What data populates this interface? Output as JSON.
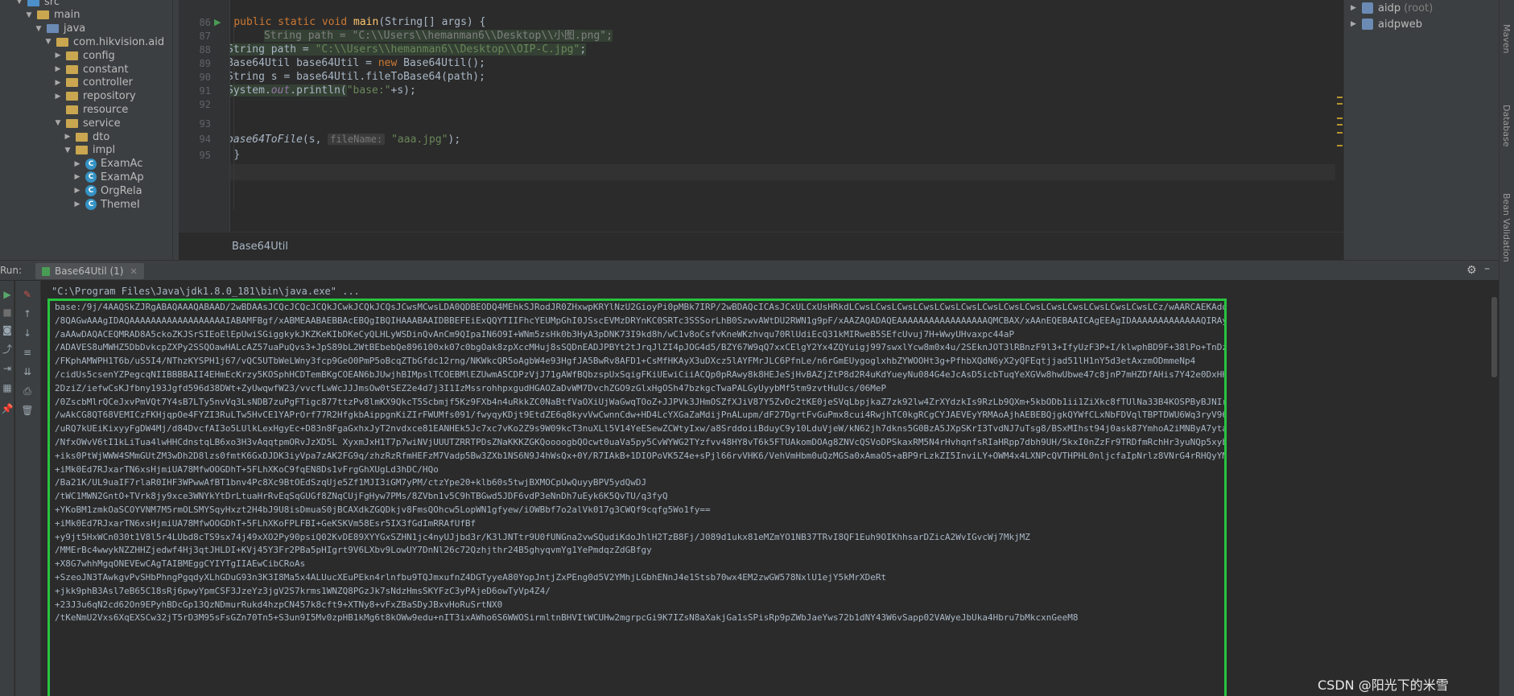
{
  "project_tree": [
    {
      "label": "src",
      "indent": 2,
      "arrow": "▼",
      "icon": "folder-src"
    },
    {
      "label": "main",
      "indent": 3,
      "arrow": "▼",
      "icon": "folder"
    },
    {
      "label": "java",
      "indent": 4,
      "arrow": "▼",
      "icon": "folder-blue"
    },
    {
      "label": "com.hikvision.aid",
      "indent": 5,
      "arrow": "▼",
      "icon": "folder"
    },
    {
      "label": "config",
      "indent": 6,
      "arrow": "▶",
      "icon": "folder"
    },
    {
      "label": "constant",
      "indent": 6,
      "arrow": "▶",
      "icon": "folder"
    },
    {
      "label": "controller",
      "indent": 6,
      "arrow": "▶",
      "icon": "folder"
    },
    {
      "label": "repository",
      "indent": 6,
      "arrow": "▶",
      "icon": "folder"
    },
    {
      "label": "resource",
      "indent": 6,
      "arrow": "",
      "icon": "folder"
    },
    {
      "label": "service",
      "indent": 6,
      "arrow": "▼",
      "icon": "folder"
    },
    {
      "label": "dto",
      "indent": 7,
      "arrow": "▶",
      "icon": "folder"
    },
    {
      "label": "impl",
      "indent": 7,
      "arrow": "▼",
      "icon": "folder"
    },
    {
      "label": "ExamAc",
      "indent": 8,
      "arrow": "▶",
      "icon": "class"
    },
    {
      "label": "ExamAp",
      "indent": 8,
      "arrow": "▶",
      "icon": "class"
    },
    {
      "label": "OrgRela",
      "indent": 8,
      "arrow": "▶",
      "icon": "class"
    },
    {
      "label": "ThemeI",
      "indent": 8,
      "arrow": "▶",
      "icon": "class"
    }
  ],
  "editor": {
    "line_numbers": [
      "86",
      "87",
      "88",
      "89",
      "90",
      "91",
      "92",
      "93",
      "94",
      "95"
    ],
    "tab_label": "Base64Util",
    "lines": {
      "l86_kw": "public static void ",
      "l86_fn": "main",
      "l86_rest": "(String[] args) {",
      "l88_cmt": "//",
      "l88_code": "String path = ",
      "l88_str": "\"C:\\\\Users\\\\hemanman6\\\\Desktop\\\\小图.png\"",
      "l88_end": ";",
      "l89_code": "String path = ",
      "l89_str": "\"C:\\\\Users\\\\hemanman6\\\\Desktop\\\\OIP-C.jpg\"",
      "l89_end": ";",
      "l90_code": "Base64Util base64Util = ",
      "l90_kw": "new ",
      "l90_end": "Base64Util();",
      "l91_code": "String s = base64Util.fileToBase64(path);",
      "l92_a": "System.",
      "l92_field": "out",
      "l92_b": ".println(",
      "l92_str": "\"base:\"",
      "l92_c": "+s);",
      "l94_it": "base64ToFile",
      "l94_a": "(s, ",
      "l94_hint": "fileName:",
      "l94_str": " \"aaa.jpg\"",
      "l94_b": ");",
      "l95": "}",
      "l96": "}"
    }
  },
  "maven": {
    "items": [
      {
        "label": "aidp",
        "suffix": "(root)"
      },
      {
        "label": "aidpweb",
        "suffix": ""
      }
    ]
  },
  "right_bar": {
    "tabs": [
      "Maven",
      "Database",
      "Bean Validation"
    ]
  },
  "run": {
    "title": "Run:",
    "tab_label": "Base64Util (1)",
    "command": "\"C:\\Program Files\\Java\\jdk1.8.0_181\\bin\\java.exe\" ...",
    "output": [
      "base:/9j/4AAQSkZJRgABAQAAAQABAAD/2wBDAAsJCQcJCQcJCQkJCwkJCQkJCQsJCwsMCwsLDA0QDBEODQ4MEhkSJRodJR0ZHxwpKRYlNzU2GioyPi0pMBk7IRP/2wBDAQcICAsJCxULCxUsHRkdLCwsLCwsLCwsLCwsLCwsLCwsLCwsLCwsLCwsLCwsLCwsLCwsLCwsLCwsLCz/wAARCAEKAdoDASIAAhEBAxEB",
      "/8QAGwAAAgIDAQAAAAAAAAAAAAAAAAAAIABAMFBgf/xABMEAABAEBBAcEBQgIBQIHAAABAAIDBBEFEiExQQYTIIFhcYEUMpGhI0JSscEVMzDRYnKC0SRTc3SSSorLhB0SzwvAWtDU2RWN1g9pF/xAAZAQADAQEAAAAAAAAAAAAAAAAAQMCBAX/xAAnEQEBAAICAgEEAgIDAAAAAAAAAAAAAQIRAyESMUEEEzJRFCJhdkTNCUv",
      "/aAAwDAQACEQMRAD8A5ckoZKJSrSIEoElEpUwiSGiggkykJKZKeKIbDKeCyQLHLyWSDinQvAnCm9QIpaIN6O9I+WNm5zsHk0b3HyA3pDNK73I9kd8h/wC1v8oCsfvKneWKzhvqu70RlUdiEcQ31kMIRweB5SEfcUvuj7H+WwyUHvaxpc44aP",
      "/ADAVES8uMWHZ5DbDvkcpZXPy2SSQOawHALcAZ57uaPuQvs3+JpS89bL2WtBEbebQe896100xk07c0bgOak8zpXccMHuj8sSQDnEADJPBYt2tJrqJlZI4pJOG4d5/BZY67W9qQ7xxCElgY2Yx4ZQYuigj997swxlYcw8m0x4u/2SEknJOT3lRBnzF9l3+IfyUzF3P+I/klwphBD9F+38lPo+TnDzAP3FDcmIJNhp4PHqCFNkngWinY",
      "/FKphAMWPH1T6b/uS5I4/NThzKYSPH1j67/vQC5UTbWeLWny3fcp9GeO0PmP5oBcqZTbGfdc12rng/NKWkcQR5oAgbW4e93HgfJA5BwRv8AFD1+CsMfHKAyX3uDXcz5lAYFMrJLC6PfnLe/n6rGmEUygoglxhbZYWOOHt3g+PfhbXQdN6yX2yQFEqtjjad51lH1nY5d3etAxzmODmmeNp4",
      "/cidUs5csenYZPegcqNIIBBBBAII4EHmEcKrzy5KOSphHCDTemBKgCOEAN6bJUwjhBIMpslTCOEBMlEZUwmASCDPzVjJ71gAWfBQbzspUxSqigFKiUEwiCiiACQp0pRAwy8k8HEJeSjHvBAZjZtP8d2R4uKdYueyNu084G4eJcAsD5icbTuqYeXGVw8hwUbwe47c8jnP7mHZDfAHis7Y42e0DxHH13rF9qk7",
      "2DziZ/iefwCsKJfbny193Jgfd596d38DWt+ZyUwqwfW23/vvcfLwWcJJJmsOw0tSEZ2e4d7j3I1IzMssrohhpxgudHGAOZaDvWM7DvchZGO9zGlxHgOSh47bzkgcTwaPALGyUyybMf5tm9zvtHuUcs/06MeP",
      "/0ZscbMlrQCeJxvPmVQt7Y4sB7LTy5nvVq3LsNDB7zuPgFTigc877ttzPv8lmKX9QkcT5Scbmjf5Kz9FXb4n4uRkkZC0NaBtfVaOXiUjWaGwqTOoZ+JJPVk3JHmOSZfXJiV87Y5ZvDc2tKE0jeSVqLbpjkaZ7zk92lw4ZrXYdzkIs9RzLb9QXm+5kbODb1ii1ZiXkc8fTUlNa33B4KOSPByBJNIrbT9j5rPmYpi6TxgnU6L+cPTBBwvFqSq8BfzJPnUIGKNxcHGjUcdlu2t+dZGnl2WXHQ5bwrWg0Eb1jRLT2GrBFAbCGMzo21x3t0R+eWUsOXjWSRjqo+PBfDR3WsjM3uWDBmrG9e/zTa3hfVnd+vbI8U+SMQTcI7f",
      "/wAkCG8QT68VEMICzFKHjqpOe4FYZI3RuLTw5HvCE1YAPrOrf77R2HfgkbAippgnKiZIrFWUMfs091/fwyqyKDjt9EtdZE6q8kyvVwCwnnCdw+HD4LcYXGaZaMdijPnALupm/dF27DgrtFvGuPmx8cui4RwjhTC0kgRCgCYJAEVEyYRMAoAjhAEBEBQjgkQYWfCLxNbFDVqlTBPTDWU6Wq3ryV96TZXr5rAfgAmBDGdALT4Ofv8Ri6UcG9wWjGWjIdW",
      "/uRQ7kUEiKixyyFgDW4Mj/d84DvcfAI3o5LUlkLexHgyEc+D83n8FgaGxhxJyT2nvdxce81EANHEk5Jc7xc7vKo2Z9s9W09kcT3nuXLl5V14YeESewZCWtyIxw/a8SrddoiiBduyC9y10LduVjeW/kN62jh7dkns5G0BzA5JXpSKrI3TvdNJ7uTsg8/BSxMIhst94j0ask87YmhoA2iMNByA7yta4l/xJJyT3nV3RIVDJJJyT3q/6RpJ",
      "/NfxOWvV6tI1kLiTua4lwHHCdnstqLB6xo3H3vAqqtpmORvJzXD5L XyxmJxH1T7p7wiNVjUUUTZRRTPDsZNaKKKZGKQoooogbQOcwt0uaVa5py5CvWYWG2TYzfvv48HY8vT6k5FTUAkomDOAg8ZNVcQSVoDPSkaxRM5N4rHvhqnfsRIaHRpp7dbh9UH/5kxI0nZzFr9TRDfmRchHr3yuNQp5xybg9kLNtlp+3/Qp2Ee",
      "+iks0PtWjWWW4SMmGUtZM3wDh2D8lzs0fmtK6GxDJDK3iyVpa7zAK2FG9q/zhzRzRfmHEFzM7Vadp5Bw3ZXb1NS6N9J4hWsQx+0Y/R7IAkB+1DIOPoVK5Z4e+sPjl66rvVHK6/VehVmHbm0uQzMGSa0xAmaO5+aBP9rLzkZI5InviLY+OWM4x4LXNPcQVTHPHL0nljcfaIpNrlz8VNrG4rRHQyYMqIBydsbX6hja8R/i31jTADGHR4k1NSBNfvb08HqZ7z8c3Hbm3oq7uwC9ZbmuLXw9ZhQmbkc7E",
      "+iMk0Ed7RJxarTN6xsHjmiUA78MfwOOGDhT+5FLhXKoC9fqEN8Ds1vFrgGhXUgLd3hDC/HQo",
      "/Ba21K/UL9uaIF7rlaR0IHF3WPwwAfBT1bnv4Pc8Xc9BtOEdSzqUje5Zf1MJI3iGM7yPM/ctzYpe20+klb60s5twjBXMOCpUwQuyyBPV5ydQwDJ",
      "/tWC1MWN2GntO+TVrk8jy9xce3WNYkYtDrLtuaHrRvEqSqGUGf8ZNqCUjFgHyw7PMs/8ZVbn1v5C9hTBGwd5JDF6vdP3eNnDh7uEyk6K5QvTU/q3fyQ",
      "+YKoBM1zmkOaSCOYVNM7M5rmOLSMYSqyHxzt2H4bJ9U8isDmuaS0jBCAXdkZGQDkjv8FmsQOhcw5LopWN1gfyew/iOWBbf7o2alVk017g3CWQf9cqfg5Wo1fy==",
      "+iMk0Ed7RJxarTN6xsHjmiUA78MfwOOGDhT+5FLhXKoFPLFBI+GeKSKVm58Esr5IX3fGdImRRAfUfBf",
      "+y9jt5HxWCn030t1V8l5r4LUbd8cTS9sx74j49xXO2Py90psiQ02KvDE89XYYGxSZHN1jc4nyUJjbd3r/K3lJNTtr9U0fUNGna2vwSQudiKdoJhlH2TzB8Fj/J089d1ukx81eMZmYO1NB37TRvI8QF1Euh9OIKhhsarDZicA2WvIGvcWj7MkjMZ",
      "/MMErBc4wwykNZZHHZjedwf4Hj3qtJHLDI+KVj45Y3Fr2PBa5pHIgrt9V6LXbv9LowUY7DnNl26c72Qzhjthr24B5ghyqvmYg1YePmdqzZdGBfgy",
      "+X8G7whhMgqONEVEwCAgTAIBMEggCYIYTgIIAEwCibCRoAs",
      "+SzeoJN3TAwkgvPvSHbPhngPgqdyXLhGDuG93n3K3I8Ma5x4ALUucXEuPEkn4rlnfbu9TQJmxufnZ4DGTyyeA80YopJntjZxPEng0d5V2YMhjLGbhENnJ4e1Stsb70wx4EM2zwGW578NxlU1ejY5kMrXDeRt",
      "+jkk9phB3Asl7eB65C18sRj6pwyYpmCSF3JzeYz3jgV2S7krms1WNZQ8PGzJk7sNdzHmsSKYFzC3yPAjeD6owTyVp4Z4/",
      "+23J3u6qN2cd62On9EPyhBDcGp13QzNDmurRukd4hzpCN457k8cft9+XTNy8+vFxZBaSDyJBxvHoRuSrtNX0",
      "/tKeNmU2Vxs6XqEXSCw32jT5rD3M95sFsGZn70Tn5+S3un9I5Mv0zpHB1kMg6t8kOWw9edu+nIT3ixAWho6S6WWOSirmltnBHVItWCUHw2mgrpcGi9K7IZsN8aXakjGa1sSPisRp9pZWbJaeYws72b1dNY43W6vSapp02VAWyeJbUka4Hbru7bMkcxnGeeM8"
    ]
  },
  "watermark": "CSDN @阳光下的米雪",
  "colors": {
    "output_highlight_border": "#27c43f",
    "string_color": "#6a8759",
    "keyword_color": "#cc7832",
    "method_color": "#ffc66d"
  }
}
